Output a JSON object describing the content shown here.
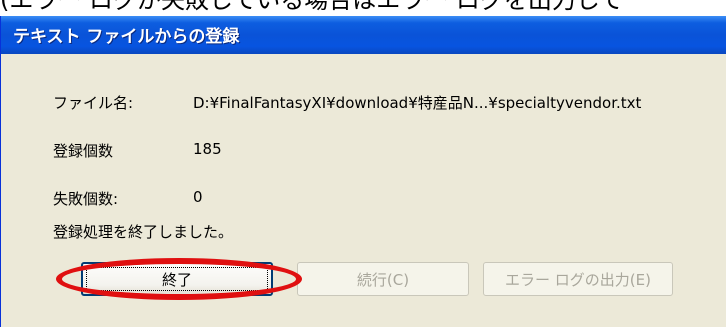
{
  "background_text": "(エラー ログが失敗している場合はエラー ログを出力して",
  "window": {
    "title": "テキスト ファイルからの登録"
  },
  "fields": {
    "file_label": "ファイル名:",
    "file_value": "D:¥FinalFantasyXI¥download¥特産品N...¥specialtyvendor.txt",
    "registered_label": "登録個数",
    "registered_value": "185",
    "failed_label": "失敗個数:",
    "failed_value": "0"
  },
  "message": "登録処理を終了しました。",
  "buttons": {
    "end": "終了",
    "continue": "続行(C)",
    "error_log": "エラー ログの出力(E)"
  },
  "colors": {
    "titlebar": "#0a53d8",
    "dialog_bg": "#ece9d8",
    "highlight_ellipse": "#e01010"
  }
}
